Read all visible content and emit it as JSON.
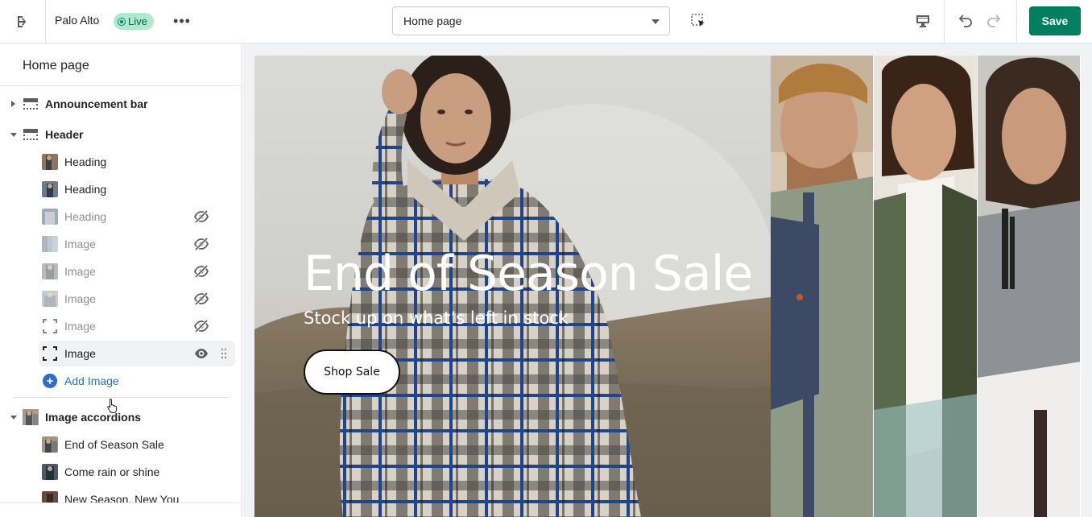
{
  "topbar": {
    "exit_icon": "exit-icon",
    "store_name": "Palo Alto",
    "status": "Live",
    "more_icon": "more-horizontal-icon",
    "page_select": "Home page",
    "inspector_icon": "select-inspect-icon",
    "device_icon": "desktop-icon",
    "undo_icon": "undo-icon",
    "redo_icon": "redo-icon",
    "save_label": "Save"
  },
  "sidebar": {
    "title": "Home page",
    "sections": [
      {
        "label": "Announcement bar",
        "expanded": false
      },
      {
        "label": "Header",
        "expanded": true
      },
      {
        "label": "Image accordions",
        "expanded": true
      }
    ],
    "header_blocks": [
      {
        "label": "Heading",
        "hidden": false
      },
      {
        "label": "Heading",
        "hidden": false
      },
      {
        "label": "Heading",
        "hidden": true
      },
      {
        "label": "Image",
        "hidden": true
      },
      {
        "label": "Image",
        "hidden": true
      },
      {
        "label": "Image",
        "hidden": true
      },
      {
        "label": "Image",
        "hidden": true
      },
      {
        "label": "Image",
        "hidden": false,
        "active": true
      }
    ],
    "add_block": "Add Image",
    "accordion_blocks": [
      {
        "label": "End of Season Sale"
      },
      {
        "label": "Come rain or shine"
      },
      {
        "label": "New Season, New You"
      }
    ]
  },
  "preview": {
    "hero_title": "End of Season Sale",
    "hero_subtitle": "Stock up on what’s left in stock",
    "hero_button": "Shop Sale"
  },
  "colors": {
    "primary": "#008060",
    "link": "#2c6ecb",
    "live_badge": "#aee9d1"
  }
}
